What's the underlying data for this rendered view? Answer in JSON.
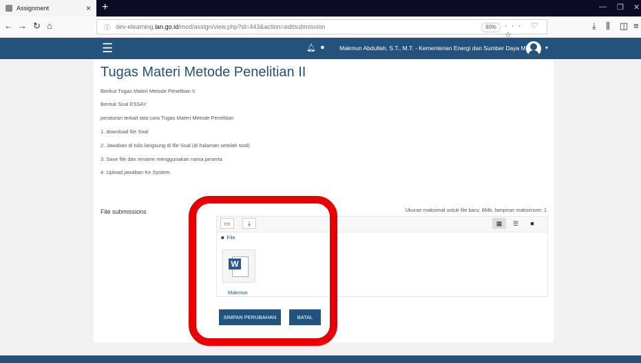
{
  "browser": {
    "tab_title": "Assignment",
    "tab_close": "×",
    "new_tab": "+",
    "url_prefix": "dev-elearning.",
    "url_domain": "lan.go.id",
    "url_rest": "/mod/assign/view.php?id=443&action=editsubmission",
    "zoom": "90%",
    "url_actions": "··· ♡ ☆"
  },
  "nav": {
    "user_name": "Makmun Abdullah, S.T., M.T. - Kementerian Energi dan Sumber Daya Mineral"
  },
  "page": {
    "title": "Tugas Materi Metode Penelitian II",
    "paragraphs": [
      "Berikut Tugas Materi Metode Penelitian II",
      "Bentuk Soal ESSAY",
      "peraturan terkait tata cara Tugas Materi Metode Penelitian",
      "1. download file Soal",
      "2. Jawaban di tulis langsung di file Soal (di halaman setelah soal)",
      "3. Save file dan rename menggunakan nama peserta",
      "4. Upload jawaban Ke System."
    ]
  },
  "submission": {
    "label": "File submissions",
    "max_note": "Ukuran maksimal untuk file baru: 8Mb, lampiran maksimum: 1",
    "breadcrumb": "File",
    "file_name": "Makmun",
    "file_type_letter": "W",
    "save_button": "SIMPAN PERUBAHAN",
    "cancel_button": "BATAL"
  },
  "colors": {
    "brand": "#23527c",
    "highlight": "#ea0000"
  }
}
